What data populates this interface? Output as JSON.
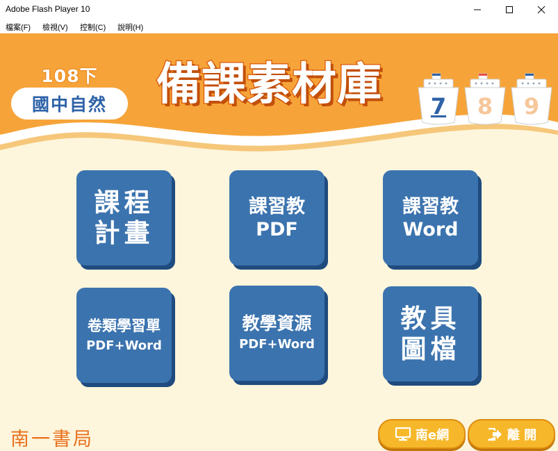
{
  "window": {
    "title": "Adobe Flash Player 10",
    "controls": {
      "minimize": "minimize-icon",
      "maximize": "maximize-icon",
      "close": "close-icon"
    }
  },
  "menu": [
    {
      "label": "檔案(F)"
    },
    {
      "label": "檢視(V)"
    },
    {
      "label": "控制(C)"
    },
    {
      "label": "說明(H)"
    }
  ],
  "header": {
    "grade_year": "108下",
    "subject": "國中自然",
    "title": "備課素材庫",
    "grades": [
      {
        "label": "7",
        "color": "#2e62a8",
        "flag": "#2e62a8"
      },
      {
        "label": "8",
        "color": "#f6c79a",
        "flag": "#e84a4a"
      },
      {
        "label": "9",
        "color": "#f6c79a",
        "flag": "#2e62a8"
      }
    ]
  },
  "tiles": [
    {
      "line1": "課程",
      "line2": "計畫"
    },
    {
      "line1": "課習教",
      "line2": "PDF"
    },
    {
      "line1": "課習教",
      "line2": "Word"
    },
    {
      "line1": "卷類學習單",
      "line2": "PDF+Word"
    },
    {
      "line1": "教學資源",
      "line2": "PDF+Word"
    },
    {
      "line1": "教具",
      "line2": "圖檔"
    }
  ],
  "footer": {
    "publisher": "南一書局",
    "nan_e_button": "南e網",
    "exit_button": "離 開"
  },
  "colors": {
    "accent_orange": "#f6a43a",
    "tile_blue": "#3b73ae",
    "background_cream": "#fdf6dc",
    "button_yellow": "#f6b82a"
  }
}
